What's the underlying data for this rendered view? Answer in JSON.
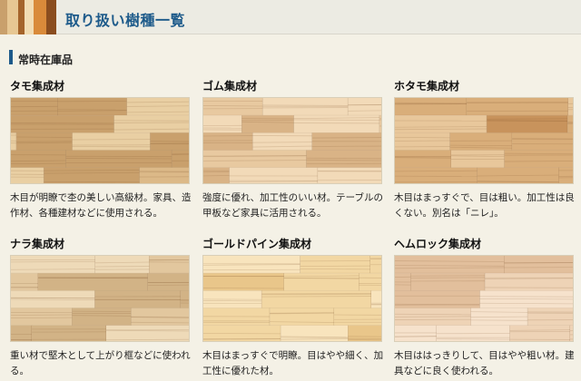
{
  "header": {
    "title": "取り扱い樹種一覧",
    "logo_colors": [
      "#c9a06c",
      "#e7c793",
      "#a5642b",
      "#f2dcb3",
      "#d98a3a",
      "#8a4d1f"
    ]
  },
  "section": {
    "title": "常時在庫品"
  },
  "cards": [
    {
      "name": "タモ集成材",
      "description": "木目が明瞭で杢の美しい高級材。家具、造作材、各種建材などに使用される。",
      "wood_colors": [
        "#dcb988",
        "#e9cfa3",
        "#c9a06c"
      ]
    },
    {
      "name": "ゴム集成材",
      "description": "強度に優れ、加工性のいい材。テーブルの甲板など家具に活用される。",
      "wood_colors": [
        "#e8c9a0",
        "#f2dab8",
        "#d9b386"
      ]
    },
    {
      "name": "ホタモ集成材",
      "description": "木目はまっすぐで、目は粗い。加工性は良くない。別名は「ニレ」。",
      "wood_colors": [
        "#d9ae7a",
        "#e8c79b",
        "#c8935c"
      ]
    },
    {
      "name": "ナラ集成材",
      "description": "重い材で堅木として上がり框などに使われる。",
      "wood_colors": [
        "#e2c79e",
        "#eedab8",
        "#d2b386"
      ]
    },
    {
      "name": "ゴールドパイン集成材",
      "description": "木目はまっすぐで明瞭。目はやや細く、加工性に優れた材。",
      "wood_colors": [
        "#f2d7a3",
        "#f8e4bd",
        "#e9c68a"
      ]
    },
    {
      "name": "ヘムロック集成材",
      "description": "木目ははっきりして、目はやや粗い材。建具などに良く使われる。",
      "wood_colors": [
        "#eed3b6",
        "#f6e2cc",
        "#e2bf9c"
      ]
    }
  ]
}
